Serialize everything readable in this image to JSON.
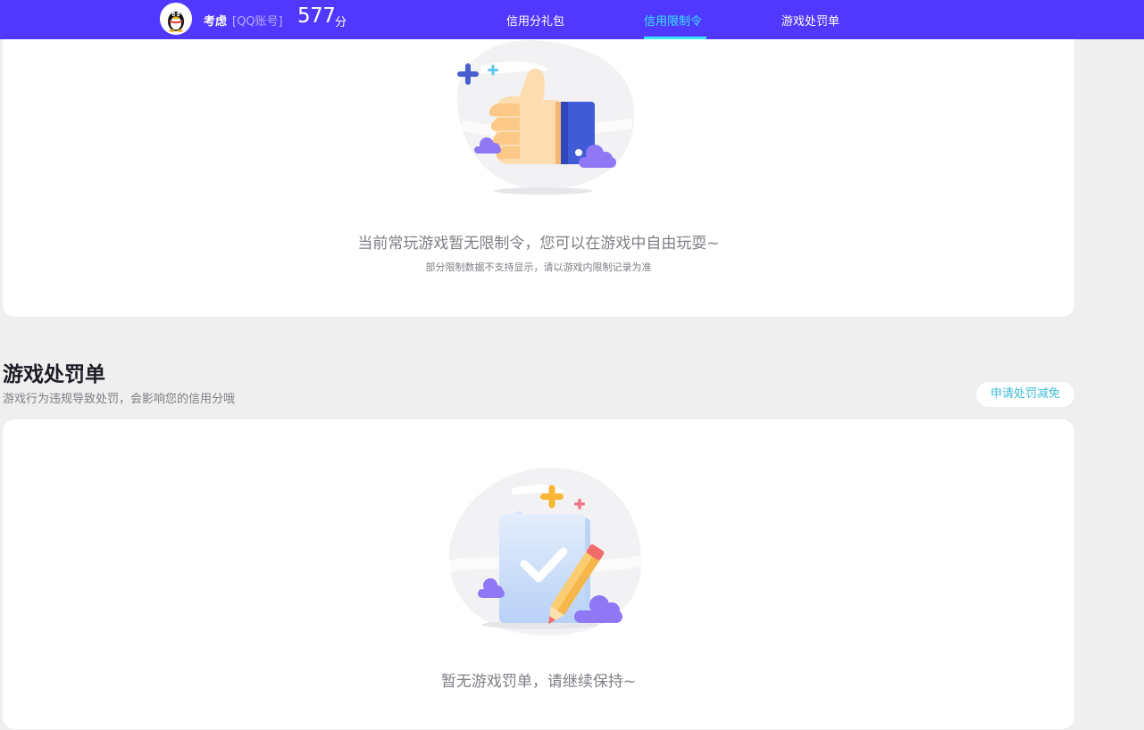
{
  "header": {
    "user_name": "考虑",
    "account_type": "[QQ账号]",
    "score": "577",
    "score_unit": "分",
    "tabs": [
      {
        "label": "信用分礼包"
      },
      {
        "label": "信用限制令"
      },
      {
        "label": "游戏处罚单"
      }
    ],
    "active_tab": "信用限制令",
    "accent_color": "#5138fe",
    "active_color": "#35e6ff"
  },
  "restriction_card": {
    "message": "当前常玩游戏暂无限制令，您可以在游戏中自由玩耍~",
    "note": "部分限制数据不支持显示，请以游戏内限制记录为准"
  },
  "penalty_section": {
    "title": "游戏处罚单",
    "description": "游戏行为违规导致处罚，会影响您的信用分哦",
    "appeal_button": "申请处罚减免",
    "empty_message": "暂无游戏罚单，请继续保持~"
  }
}
